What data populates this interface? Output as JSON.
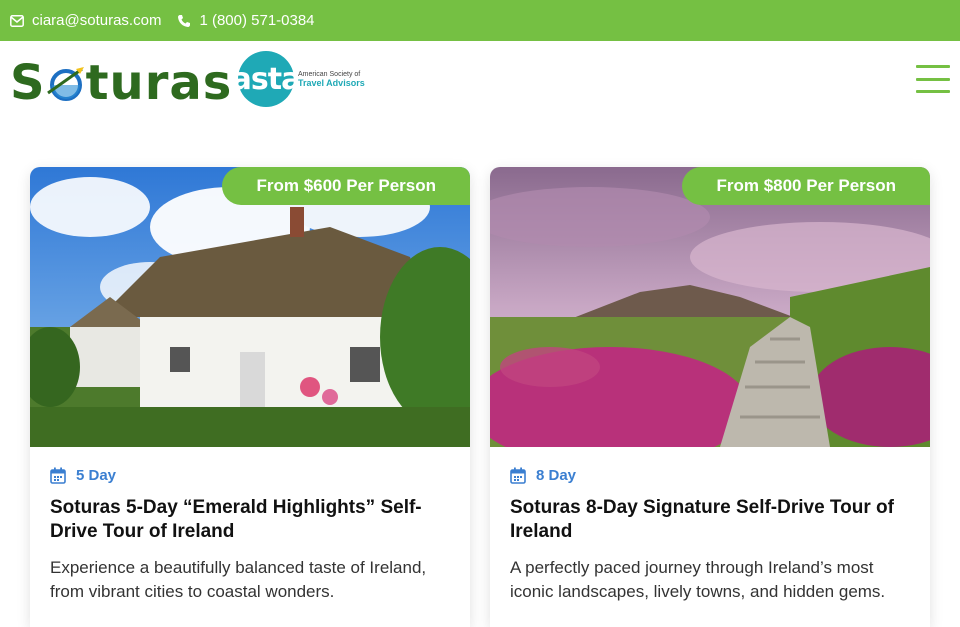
{
  "topbar": {
    "email": "ciara@soturas.com",
    "phone": "1 (800) 571-0384",
    "bg_color": "#75c043"
  },
  "header": {
    "logo_text_left": "S",
    "logo_text_right": "turas",
    "asta_text": "asta",
    "asta_line1": "American Society of",
    "asta_line2": "Travel Advisors",
    "asta_mark": "®"
  },
  "cards": [
    {
      "price": "From $600 Per Person",
      "days": "5 Day",
      "title": "Soturas 5-Day “Emerald Highlights” Self-Drive Tour of Ireland",
      "description": "Experience a beautifully balanced taste of Ireland, from vibrant cities to coastal wonders."
    },
    {
      "price": "From $800 Per Person",
      "days": "8 Day",
      "title": "Soturas 8-Day Signature Self-Drive Tour of Ireland",
      "description": "A perfectly paced journey through Ireland’s most iconic landscapes, lively towns, and hidden gems."
    }
  ],
  "colors": {
    "accent": "#75c043",
    "day_blue": "#3b7fd1",
    "logo_green": "#2e6a1f",
    "asta_teal": "#1fa9b6"
  }
}
